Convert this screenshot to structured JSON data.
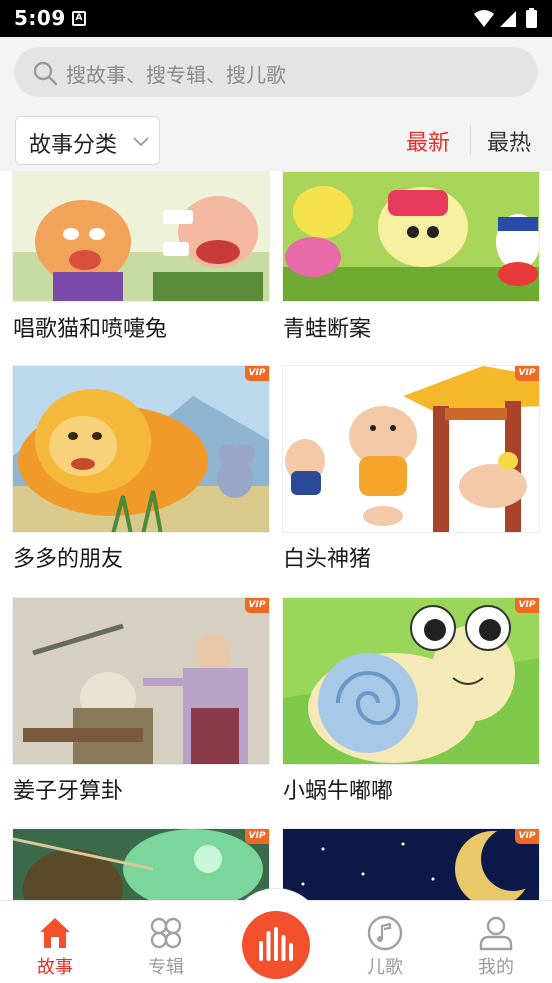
{
  "status_bar": {
    "time": "5:09",
    "notification_glyph": "A"
  },
  "search": {
    "placeholder": "搜故事、搜专辑、搜儿歌"
  },
  "filter": {
    "category_label": "故事分类",
    "sort_newest": "最新",
    "sort_hot": "最热",
    "active_sort": "最新"
  },
  "colors": {
    "accent": "#e8302a",
    "vip": "#f06a24",
    "player": "#f2502c",
    "inactive": "#9a9a9a"
  },
  "stories": [
    {
      "title": "唱歌猫和喷嚏兔",
      "vip": false
    },
    {
      "title": "青蛙断案",
      "vip": false
    },
    {
      "title": "多多的朋友",
      "vip": true,
      "vip_label": "VIP"
    },
    {
      "title": "白头神猪",
      "vip": true,
      "vip_label": "VIP"
    },
    {
      "title": "姜子牙算卦",
      "vip": true,
      "vip_label": "VIP"
    },
    {
      "title": "小蜗牛嘟嘟",
      "vip": true,
      "vip_label": "VIP"
    },
    {
      "title": "",
      "vip": true,
      "vip_label": "VIP"
    },
    {
      "title": "",
      "vip": true,
      "vip_label": "VIP"
    }
  ],
  "bottom_nav": {
    "items": [
      {
        "label": "故事",
        "icon": "home-icon",
        "active": true
      },
      {
        "label": "专辑",
        "icon": "album-icon",
        "active": false
      },
      {
        "label": "儿歌",
        "icon": "music-disc-icon",
        "active": false
      },
      {
        "label": "我的",
        "icon": "user-icon",
        "active": false
      }
    ],
    "center_icon": "player-bars-icon"
  }
}
